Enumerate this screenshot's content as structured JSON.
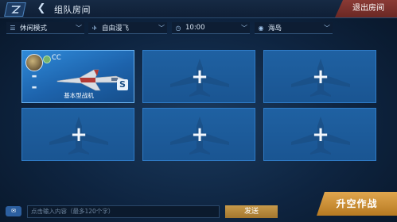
{
  "header": {
    "title": "组队房间",
    "exit_label": "退出房间"
  },
  "filters": [
    {
      "icon": "list-icon",
      "label": "休闲模式"
    },
    {
      "icon": "plane-icon",
      "label": "自由漫飞"
    },
    {
      "icon": "clock-icon",
      "label": "10:00"
    },
    {
      "icon": "map-icon",
      "label": "海岛"
    }
  ],
  "player": {
    "name": "CC",
    "plane_name": "基本型战机",
    "skill_badge": "S"
  },
  "chat": {
    "placeholder": "点击输入内容（最多120个字）",
    "send_label": "发送"
  },
  "takeoff_label": "升空作战",
  "colors": {
    "slot_bg": "#1f61a2",
    "exit_bg": "#7a302c",
    "takeoff_bg": "#d1933e",
    "send_bg": "#b88a3e"
  }
}
